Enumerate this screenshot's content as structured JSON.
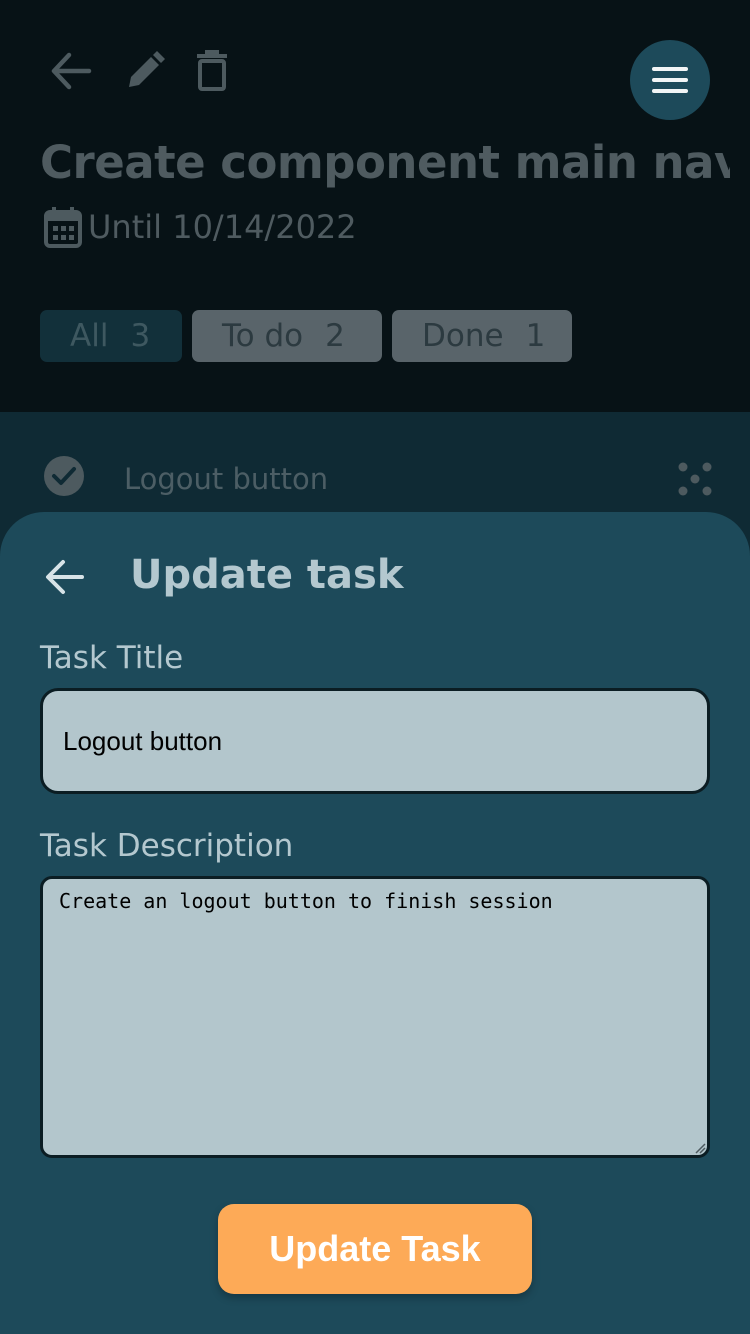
{
  "header": {
    "title": "Create component main nav",
    "date_label": "Until 10/14/2022",
    "icons": [
      "back-icon",
      "pencil-icon",
      "trash-icon",
      "menu-icon"
    ]
  },
  "filters": [
    {
      "label": "All",
      "count": "3"
    },
    {
      "label": "To do",
      "count": "2"
    },
    {
      "label": "Done",
      "count": "1"
    }
  ],
  "tasks": [
    {
      "title": "Logout button",
      "done": true
    }
  ],
  "sheet": {
    "title": "Update task",
    "task_title_label": "Task Title",
    "task_title_value": "Logout button",
    "task_description_label": "Task Description",
    "task_description_value": "Create an logout button to finish session",
    "submit_label": "Update Task"
  },
  "colors": {
    "sheet_bg": "#1d4a5a",
    "accent_button": "#fdaa57",
    "input_bg": "#b3c6cc"
  }
}
